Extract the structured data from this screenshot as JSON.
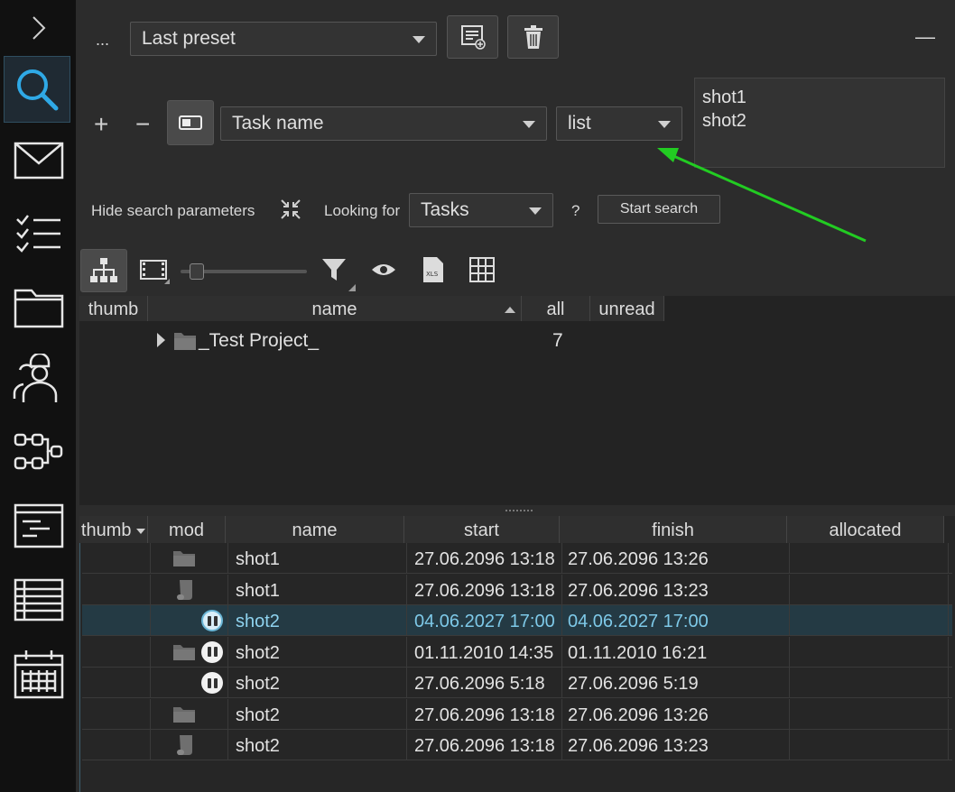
{
  "rail": {
    "items": [
      {
        "name": "expand-chevron-icon"
      },
      {
        "name": "search-icon",
        "active": true
      },
      {
        "name": "mail-icon"
      },
      {
        "name": "checklist-icon"
      },
      {
        "name": "folder-icon"
      },
      {
        "name": "users-icon"
      },
      {
        "name": "workflow-icon"
      },
      {
        "name": "console-icon"
      },
      {
        "name": "table-icon"
      },
      {
        "name": "calendar-icon"
      }
    ]
  },
  "toolbar": {
    "more_label": "...",
    "preset_value": "Last preset",
    "minimize_label": "—"
  },
  "filter": {
    "add_label": "+",
    "remove_label": "−",
    "field_value": "Task name",
    "mode_value": "list",
    "list_text": "shot1\nshot2"
  },
  "search": {
    "hide_label": "Hide search parameters",
    "looking_for_label": "Looking for",
    "looking_for_value": "Tasks",
    "help_label": "?",
    "start_label": "Start search"
  },
  "view_toolbar": {
    "icons": [
      "hierarchy-icon",
      "filmstrip-icon",
      "zoom-slider",
      "funnel-icon",
      "eye-icon",
      "xls-icon",
      "grid-icon"
    ],
    "slider_value": 0.0
  },
  "tree": {
    "columns": [
      "thumb",
      "name",
      "all",
      "unread"
    ],
    "rows": [
      {
        "name": "_Test Project_",
        "all": "7",
        "unread": ""
      }
    ]
  },
  "grid": {
    "columns": [
      "thumb",
      "mod",
      "name",
      "start",
      "finish",
      "allocated"
    ],
    "rows": [
      {
        "mod": "folder",
        "pause": false,
        "name": "shot1",
        "start": "27.06.2096 13:18",
        "finish": "27.06.2096 13:26",
        "allocated": "",
        "selected": false
      },
      {
        "mod": "file",
        "pause": false,
        "name": "shot1",
        "start": "27.06.2096 13:18",
        "finish": "27.06.2096 13:23",
        "allocated": "",
        "selected": false
      },
      {
        "mod": "none",
        "pause": true,
        "name": "shot2",
        "start": "04.06.2027 17:00",
        "finish": "04.06.2027 17:00",
        "allocated": "",
        "selected": true
      },
      {
        "mod": "folder",
        "pause": true,
        "name": "shot2",
        "start": "01.11.2010 14:35",
        "finish": "01.11.2010 16:21",
        "allocated": "",
        "selected": false
      },
      {
        "mod": "none",
        "pause": true,
        "name": "shot2",
        "start": "27.06.2096 5:18",
        "finish": "27.06.2096 5:19",
        "allocated": "",
        "selected": false
      },
      {
        "mod": "folder",
        "pause": false,
        "name": "shot2",
        "start": "27.06.2096 13:18",
        "finish": "27.06.2096 13:26",
        "allocated": "",
        "selected": false
      },
      {
        "mod": "file",
        "pause": false,
        "name": "shot2",
        "start": "27.06.2096 13:18",
        "finish": "27.06.2096 13:23",
        "allocated": "",
        "selected": false
      }
    ]
  },
  "colors": {
    "accent": "#2f7fb0",
    "arrow": "#22cc22",
    "selection": "#243a44"
  }
}
